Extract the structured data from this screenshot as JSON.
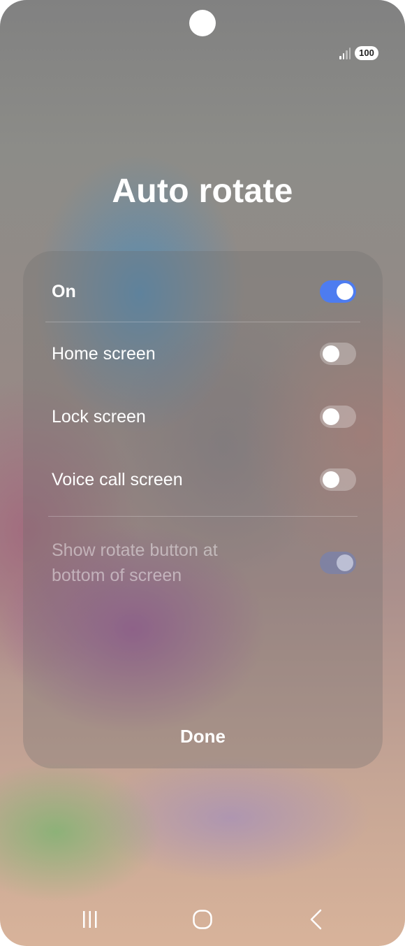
{
  "status_bar": {
    "signal_icon": "signal-bars-icon",
    "battery_level": "100"
  },
  "dialog": {
    "title": "Auto rotate",
    "items": [
      {
        "label": "On",
        "state": "on"
      },
      {
        "label": "Home screen",
        "state": "off"
      },
      {
        "label": "Lock screen",
        "state": "off"
      },
      {
        "label": "Voice call screen",
        "state": "off"
      },
      {
        "label": "Show rotate button at bottom of screen",
        "state": "on-disabled"
      }
    ],
    "done_label": "Done"
  },
  "nav_bar": {
    "recents_icon": "recent-apps-icon",
    "home_icon": "home-icon",
    "back_icon": "back-icon"
  },
  "colors": {
    "toggle_on": "#4d7cf0",
    "text": "#ffffff"
  }
}
